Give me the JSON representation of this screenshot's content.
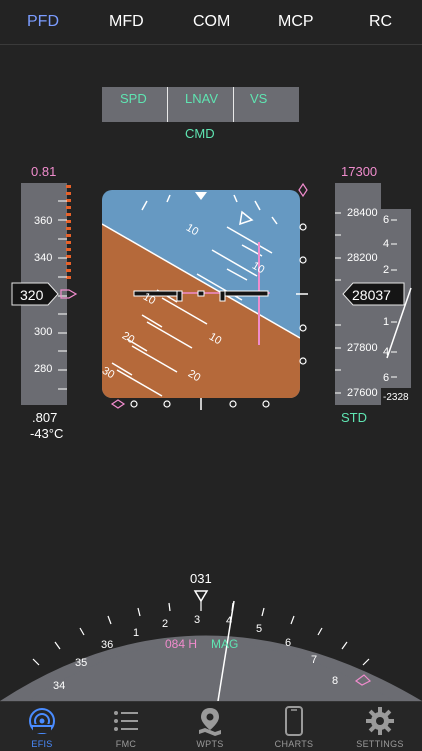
{
  "top_tabs": [
    "PFD",
    "MFD",
    "COM",
    "MCP",
    "RC"
  ],
  "top_tab_active": "PFD",
  "fma": {
    "speed_mode": "SPD",
    "lateral_mode": "LNAV",
    "vertical_mode": "VS",
    "status": "CMD"
  },
  "speed_tape": {
    "mach_target": "0.81",
    "ticks": [
      "360",
      "340",
      "320",
      "300",
      "280"
    ],
    "current": "320",
    "mach": ".807",
    "sat": "-43°C"
  },
  "attitude": {
    "pitch_labels": [
      "10",
      "10",
      "10",
      "10",
      "20",
      "20",
      "30"
    ]
  },
  "altitude_tape": {
    "selected": "17300",
    "ticks": [
      "28400",
      "28200",
      "28000",
      "27800",
      "27600"
    ],
    "current": "28037",
    "baro": "STD",
    "vs_scale": [
      "6",
      "4",
      "2",
      "1",
      "1",
      "2",
      "4",
      "6"
    ],
    "vs_value": "-2328"
  },
  "heading": {
    "current": "031",
    "selected": "084 H",
    "reference": "MAG",
    "labels": [
      "34",
      "35",
      "36",
      "1",
      "2",
      "3",
      "4",
      "5",
      "6",
      "7",
      "8"
    ]
  },
  "bottom_tabs": [
    {
      "label": "EFIS",
      "icon": "efis-icon"
    },
    {
      "label": "FMC",
      "icon": "list-icon"
    },
    {
      "label": "WPTS",
      "icon": "map-pin-icon"
    },
    {
      "label": "CHARTS",
      "icon": "tablet-icon"
    },
    {
      "label": "SETTINGS",
      "icon": "gear-icon"
    }
  ],
  "bottom_tab_active": "EFIS",
  "colors": {
    "accent": "#4a8cff",
    "fma_green": "#5fe5b2",
    "magenta": "#f08ccd",
    "sky": "#6699c2",
    "ground": "#b5693a",
    "tape": "#6b6c72"
  }
}
